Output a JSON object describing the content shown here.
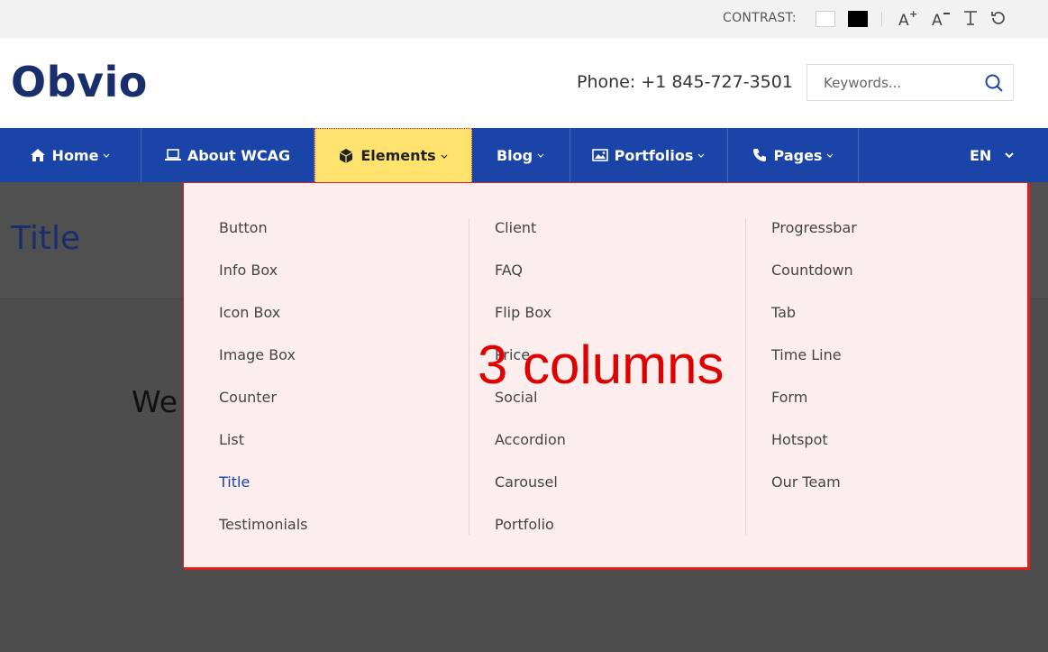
{
  "topbar": {
    "contrast_label": "CONTRAST:",
    "icons": [
      "increase-font-icon",
      "decrease-font-icon",
      "readable-font-icon",
      "reset-icon"
    ]
  },
  "header": {
    "logo": "Obvio",
    "phone": "Phone: +1 845-727-3501",
    "search_placeholder": "Keywords..."
  },
  "nav": {
    "items": [
      {
        "label": "Home",
        "icon": "home-icon"
      },
      {
        "label": "About WCAG",
        "icon": "laptop-icon"
      },
      {
        "label": "Elements",
        "icon": "cube-icon"
      },
      {
        "label": "Blog",
        "icon": ""
      },
      {
        "label": "Portfolios",
        "icon": "image-icon"
      },
      {
        "label": "Pages",
        "icon": "phone-icon"
      }
    ],
    "language": "EN"
  },
  "page": {
    "title": "Title",
    "partial_text": "We"
  },
  "dropdown": {
    "columns": [
      [
        "Button",
        "Info Box",
        "Icon Box",
        "Image Box",
        "Counter",
        "List",
        "Title",
        "Testimonials"
      ],
      [
        "Client",
        "FAQ",
        "Flip Box",
        "Price",
        "Social",
        "Accordion",
        "Carousel",
        "Portfolio"
      ],
      [
        "Progressbar",
        "Countdown",
        "Tab",
        "Time Line",
        "Form",
        "Hotspot",
        "Our Team"
      ]
    ],
    "current_item": "Title",
    "annotation": "3 columns"
  },
  "colors": {
    "nav_bg": "#1b44a9",
    "active_bg": "#ffe36e",
    "logo": "#1a2d6d",
    "dropdown_bg": "#fdeeee",
    "annotation": "#e00000"
  }
}
